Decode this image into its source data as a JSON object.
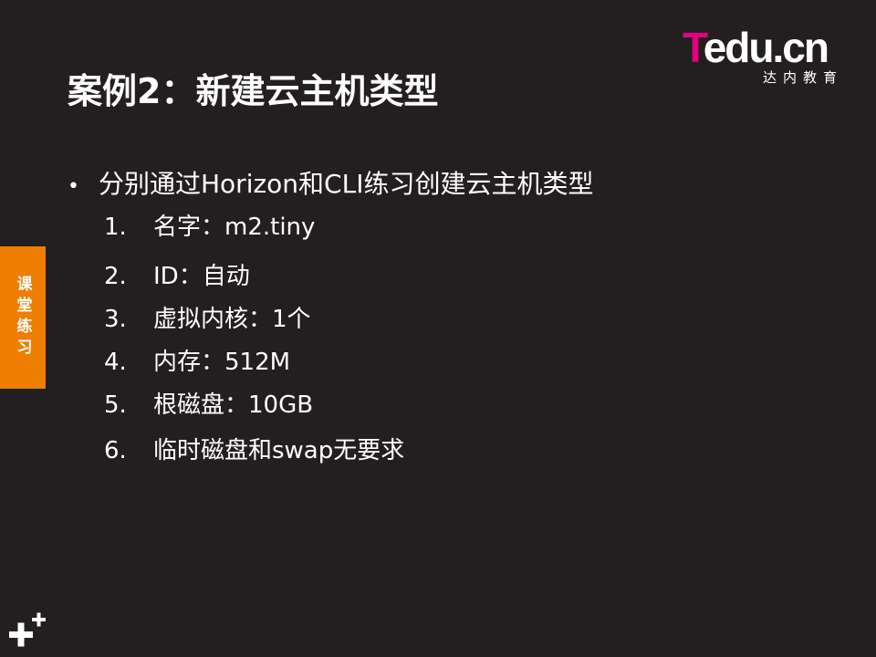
{
  "slide": {
    "title": "案例2：新建云主机类型",
    "side_tab_label": "课堂练习",
    "logo": {
      "t": "T",
      "rest": "edu.cn",
      "sub": "达内教育"
    },
    "bullet": {
      "text": "分别通过Horizon和CLI练习创建云主机类型"
    },
    "items": [
      {
        "num": "1.",
        "text": "名字：m2.tiny"
      },
      {
        "num": "2.",
        "text": "ID：自动"
      },
      {
        "num": "3.",
        "text": "虚拟内核：1个"
      },
      {
        "num": "4.",
        "text": "内存：512M"
      },
      {
        "num": "5.",
        "text": "根磁盘：10GB"
      },
      {
        "num": "6.",
        "text": "临时磁盘和swap无要求"
      }
    ],
    "icons": {
      "bullet": "bullet-dot-icon",
      "decoration": "plus-decoration-icon"
    },
    "colors": {
      "background": "#231f20",
      "accent": "#ef7d00",
      "brand": "#e4007f",
      "text": "#ffffff"
    }
  }
}
